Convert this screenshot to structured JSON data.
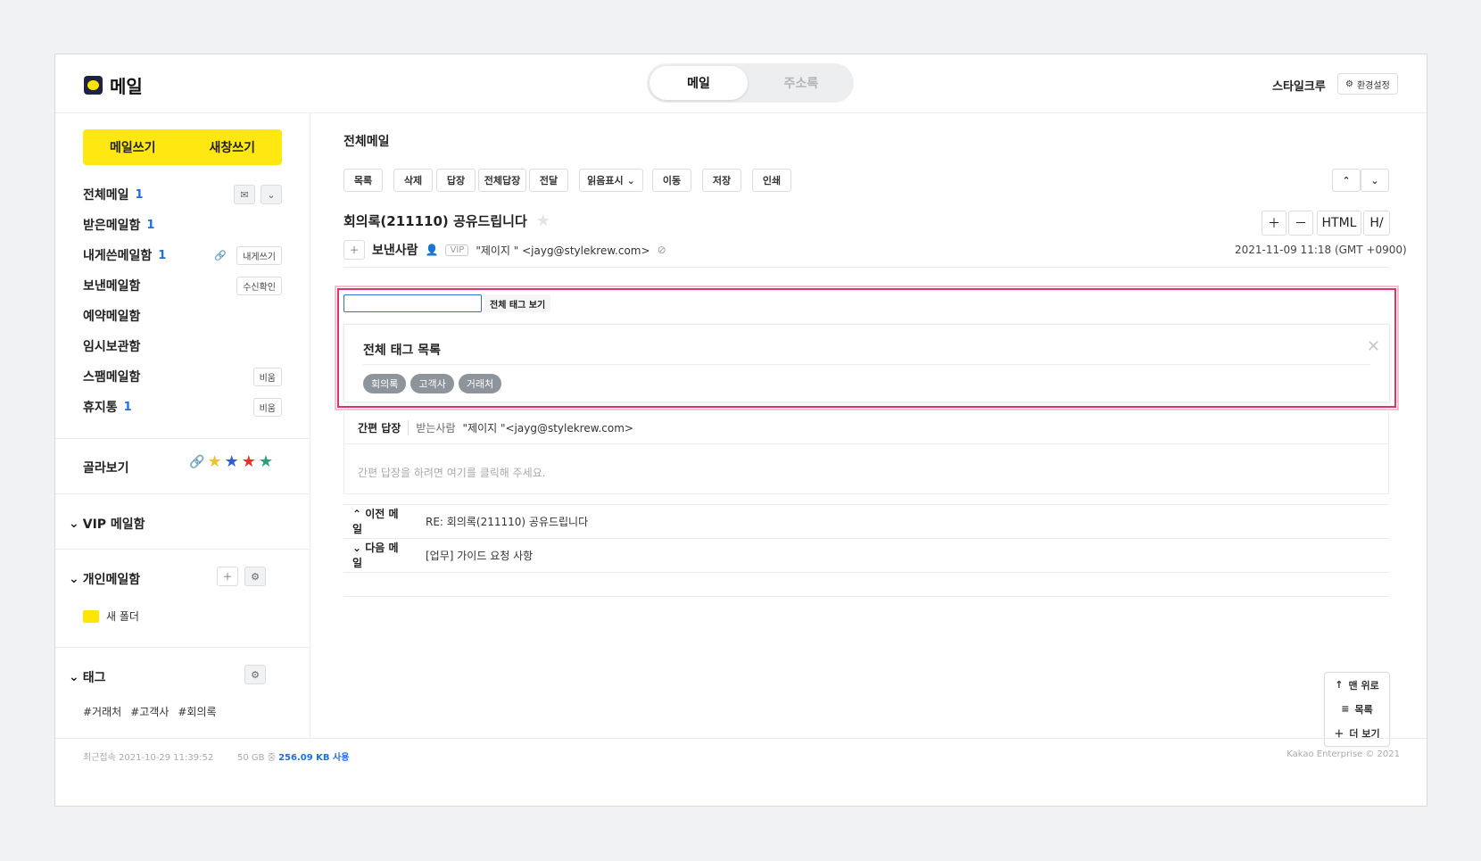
{
  "app": {
    "title": "메일",
    "user": "스타일크루",
    "settings_label": "환경설정"
  },
  "tabs": [
    {
      "label": "메일"
    },
    {
      "label": "주소록"
    }
  ],
  "compose": {
    "write": "메일쓰기",
    "new_window": "새창쓰기"
  },
  "folders": [
    {
      "label": "전체메일",
      "count": "1"
    },
    {
      "label": "받은메일함",
      "count": "1"
    },
    {
      "label": "내게쓴메일함",
      "count": "1",
      "action": "내게쓰기"
    },
    {
      "label": "보낸메일함",
      "action": "수신확인"
    },
    {
      "label": "예약메일함"
    },
    {
      "label": "임시보관함"
    },
    {
      "label": "스팸메일함",
      "action": "비움"
    },
    {
      "label": "휴지통",
      "count": "1",
      "action": "비움"
    }
  ],
  "filter": {
    "label": "골라보기",
    "star_colors": [
      "#f2c224",
      "#2f5bd8",
      "#e8312a",
      "#1fa67a"
    ]
  },
  "sections": {
    "vip": "VIP 메일함",
    "personal": "개인메일함",
    "new_folder": "새 폴더",
    "tags": "태그",
    "tag_items": [
      "#거래처",
      "#고객사",
      "#회의록"
    ]
  },
  "main": {
    "page_title": "전체메일",
    "toolbar": [
      "목록",
      "삭제",
      "답장",
      "전체답장",
      "전달",
      "읽음표시",
      "이동",
      "저장",
      "인쇄"
    ],
    "subject": "회의록(211110) 공유드립니다",
    "sender_label": "보낸사람",
    "vip": "VIP",
    "sender": "\"제이지 \" <jayg@stylekrew.com>",
    "date": "2021-11-09 11:18 (GMT +0900)",
    "view_buttons": [
      "HTML",
      "H/"
    ]
  },
  "tag_popup": {
    "all_button": "전체 태그 보기",
    "panel_title": "전체 태그 목록",
    "tags": [
      "회의록",
      "고객사",
      "거래처"
    ]
  },
  "quick_reply": {
    "label": "간편 답장",
    "to_label": "받는사람",
    "to": "\"제이지 \"<jayg@stylekrew.com>",
    "placeholder": "간편 답장을 하려면 여기를 클릭해 주세요."
  },
  "nav": {
    "prev_label": "이전 메일",
    "prev_subject": "RE: 회의록(211110) 공유드립니다",
    "next_label": "다음 메일",
    "next_subject": "[업무] 가이드 요청 사항"
  },
  "floating": {
    "top": "맨 위로",
    "list": "목록",
    "more": "더 보기"
  },
  "footer": {
    "last_login": "최근접속 2021-10-29 11:39:52",
    "quota_prefix": "50 GB 중",
    "quota_used": "256.09 KB 사용",
    "copyright": "Kakao Enterprise © 2021"
  }
}
